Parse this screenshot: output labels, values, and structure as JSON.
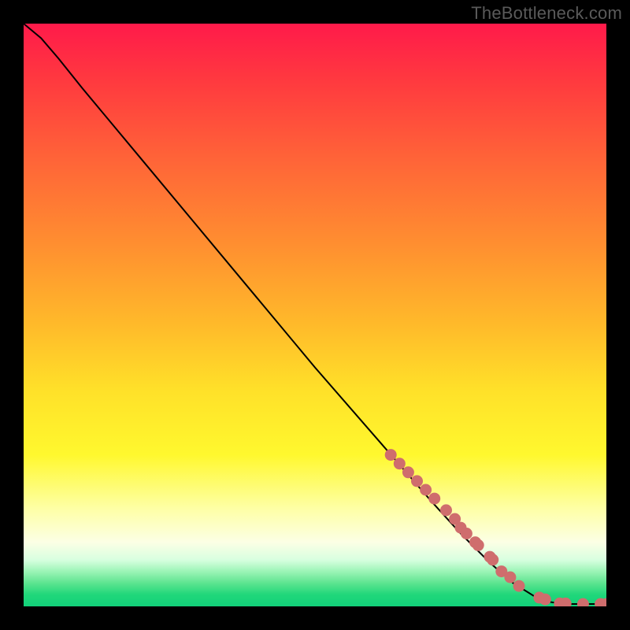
{
  "watermark": "TheBottleneck.com",
  "chart_data": {
    "type": "line",
    "title": "",
    "xlabel": "",
    "ylabel": "",
    "xlim": [
      0,
      100
    ],
    "ylim": [
      0,
      100
    ],
    "gradient_bands": [
      {
        "stop": 0,
        "color": "#ff1a4a"
      },
      {
        "stop": 10,
        "color": "#ff3a3f"
      },
      {
        "stop": 23,
        "color": "#ff6338"
      },
      {
        "stop": 38,
        "color": "#ff8f30"
      },
      {
        "stop": 52,
        "color": "#ffbb2a"
      },
      {
        "stop": 63,
        "color": "#ffe129"
      },
      {
        "stop": 74,
        "color": "#fff82e"
      },
      {
        "stop": 83,
        "color": "#feffa3"
      },
      {
        "stop": 89,
        "color": "#fcffe5"
      },
      {
        "stop": 92,
        "color": "#d8ffe0"
      },
      {
        "stop": 94,
        "color": "#9cf4b6"
      },
      {
        "stop": 96,
        "color": "#5de490"
      },
      {
        "stop": 98,
        "color": "#20d77a"
      },
      {
        "stop": 100,
        "color": "#12d17a"
      }
    ],
    "series": [
      {
        "name": "bottleneck-curve",
        "x": [
          0,
          3,
          6,
          10,
          20,
          30,
          40,
          50,
          60,
          70,
          75,
          80,
          84,
          88,
          90,
          92,
          94,
          96,
          98,
          100
        ],
        "y": [
          100,
          97.5,
          94,
          89,
          77,
          65,
          53,
          41,
          29.5,
          18,
          12.5,
          7.5,
          4,
          1.5,
          0.8,
          0.5,
          0.4,
          0.4,
          0.4,
          0.4
        ]
      }
    ],
    "scatter_points": {
      "name": "highlight-segment",
      "x": [
        63,
        64.5,
        66,
        67.5,
        69,
        70.5,
        72.5,
        74,
        75,
        76,
        77.5,
        78,
        80,
        80.5,
        82,
        83.5,
        85,
        88.5,
        89.5,
        92,
        93,
        96,
        99,
        100
      ],
      "y": [
        26,
        24.5,
        23,
        21.5,
        20,
        18.5,
        16.5,
        15,
        13.5,
        12.5,
        11,
        10.5,
        8.5,
        8,
        6,
        5,
        3.5,
        1.5,
        1.2,
        0.5,
        0.5,
        0.4,
        0.4,
        0.4
      ]
    }
  }
}
